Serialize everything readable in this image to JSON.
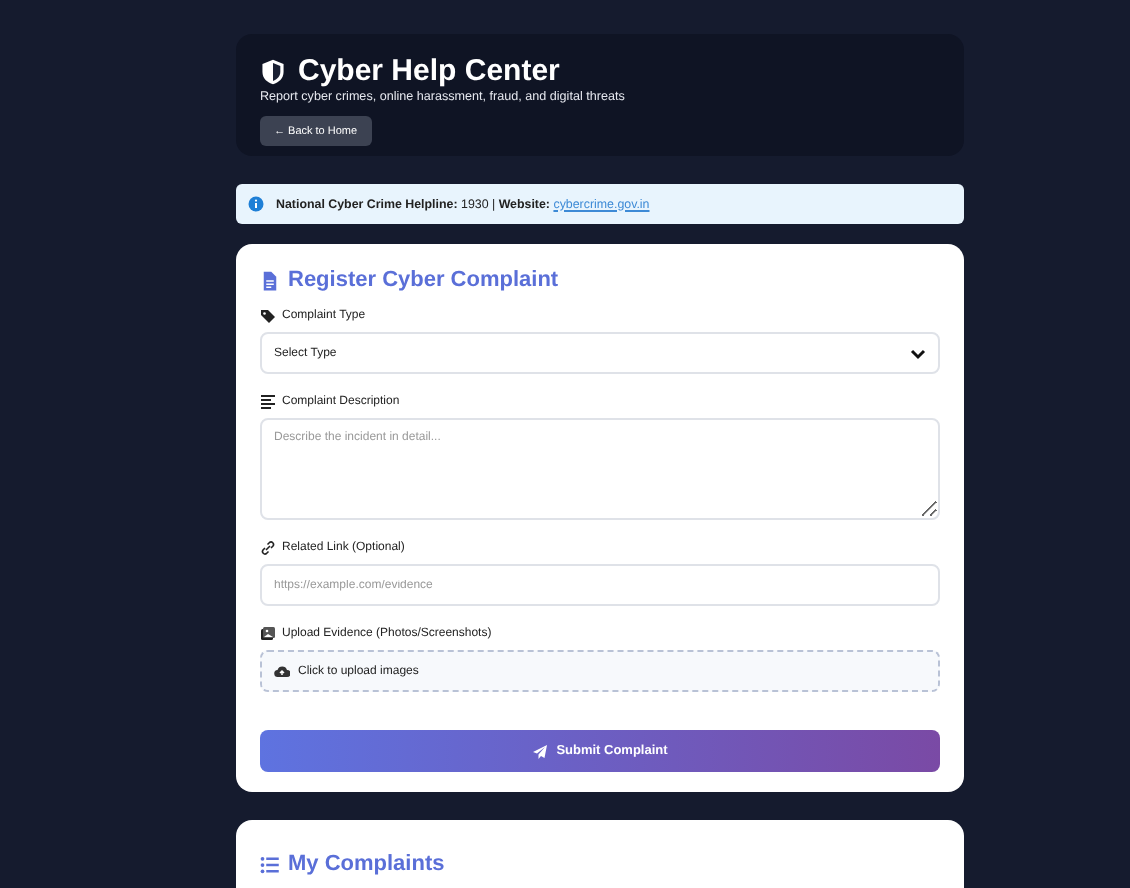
{
  "header": {
    "title": "Cyber Help Center",
    "subtitle": "Report cyber crimes, online harassment, fraud, and digital threats",
    "back_button": "← Back to Home"
  },
  "notice": {
    "text": "**National Cyber Crime Helpline:** 1930 | **Website:**",
    "link": "cybercrime.gov.in"
  },
  "form": {
    "title": "Register Cyber Complaint",
    "fields": [
      {
        "kind": "select",
        "label": "Complaint Type",
        "value": "Select Type"
      },
      {
        "kind": "textarea",
        "label": "Complaint Description",
        "placeholder": "Describe the incident in detail..."
      },
      {
        "kind": "input",
        "label": "Related Link (Optional)",
        "placeholder": "https://example.com/evidence"
      },
      {
        "kind": "upload",
        "label": "Upload Evidence (Photos/Screenshots)",
        "value": "Click to upload images"
      }
    ],
    "submit": "Submit Complaint"
  },
  "complaints": {
    "title": "My Complaints"
  }
}
